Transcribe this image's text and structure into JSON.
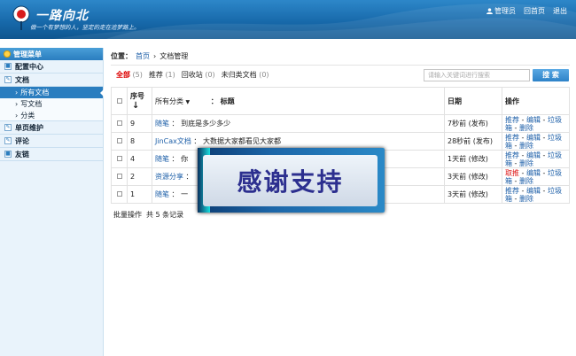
{
  "header": {
    "logo_text": "一路向北",
    "slogan": "做一个有梦想的人，坚定的走在追梦路上。",
    "nav": {
      "admin": "管理员",
      "home": "回首页",
      "logout": "退出"
    }
  },
  "sidebar": {
    "title": "管理菜单",
    "groups": [
      {
        "label": "配置中心"
      },
      {
        "label": "文档",
        "subitems": [
          "所有文档",
          "写文档",
          "分类"
        ]
      },
      {
        "label": "单页维护"
      },
      {
        "label": "评论"
      },
      {
        "label": "友链"
      }
    ]
  },
  "breadcrumb": {
    "label": "位置：",
    "home": "首页",
    "sep": "›",
    "current": "文档管理"
  },
  "filters": [
    {
      "label": "全部",
      "count": "(5)"
    },
    {
      "label": "推荐",
      "count": "(1)"
    },
    {
      "label": "回收站",
      "count": "(0)"
    },
    {
      "label": "未归类文档",
      "count": "(0)"
    }
  ],
  "search": {
    "placeholder": "请输入关键词进行搜索",
    "button": "搜 索"
  },
  "table": {
    "headers": {
      "seq": "序号",
      "sort_arrow": "↓",
      "category_select": "所有分类",
      "colon": "：",
      "title": "标题",
      "date": "日期",
      "ops": "操作"
    },
    "rows": [
      {
        "seq": "9",
        "cat": "随笔",
        "title": "到底是多少多少",
        "date": "7秒前 (发布)",
        "ops": [
          "推荐",
          "编辑",
          "垃圾箱",
          "删除"
        ],
        "first_red": false
      },
      {
        "seq": "8",
        "cat": "JinCax文档",
        "title": "大数据大家都看见大家都",
        "date": "28秒前 (发布)",
        "ops": [
          "推荐",
          "编辑",
          "垃圾箱",
          "删除"
        ],
        "first_red": false
      },
      {
        "seq": "4",
        "cat": "随笔",
        "title": "你",
        "date": "1天前 (修改)",
        "ops": [
          "推荐",
          "编辑",
          "垃圾箱",
          "删除"
        ],
        "first_red": false
      },
      {
        "seq": "2",
        "cat": "资源分享",
        "title": "",
        "date": "3天前 (修改)",
        "ops": [
          "取推",
          "编辑",
          "垃圾箱",
          "删除"
        ],
        "first_red": true
      },
      {
        "seq": "1",
        "cat": "随笔",
        "title": "一",
        "date": "3天前 (修改)",
        "ops": [
          "推荐",
          "编辑",
          "垃圾箱",
          "删除"
        ],
        "first_red": false
      }
    ]
  },
  "footer": {
    "batch": "批量操作",
    "total": "共 5 条记录"
  },
  "overlay": {
    "text": "感谢支持"
  }
}
